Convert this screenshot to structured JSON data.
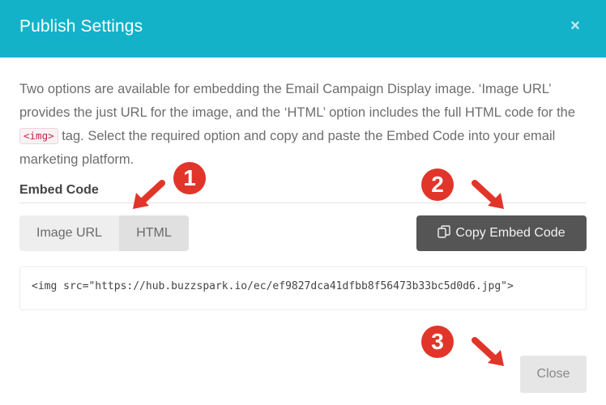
{
  "dialog": {
    "title": "Publish Settings",
    "close_glyph": "×",
    "description_part1": "Two options are available for embedding the Email Campaign Display image. ‘Image URL’ provides the just URL for the image, and the ‘HTML’ option includes the full HTML code for the ",
    "description_code": "<img>",
    "description_part2": " tag. Select the required option and copy and paste the Embed Code into your email marketing platform.",
    "section_label": "Embed Code",
    "toggle": {
      "options": [
        "Image URL",
        "HTML"
      ],
      "selected": "HTML"
    },
    "copy_button_label": "Copy Embed Code",
    "copy_icon": "copy-icon",
    "embed_code": "<img src=\"https://hub.buzzspark.io/ec/ef9827dca41dfbb8f56473b33bc5d0d6.jpg\">",
    "close_button_label": "Close"
  },
  "annotations": [
    {
      "number": "1",
      "icon": "arrow-down-left-icon"
    },
    {
      "number": "2",
      "icon": "arrow-down-right-icon"
    },
    {
      "number": "3",
      "icon": "arrow-down-right-icon"
    }
  ],
  "colors": {
    "header_bg": "#13b2c9",
    "annotation_red": "#e1352a",
    "copy_button_bg": "#555555"
  }
}
